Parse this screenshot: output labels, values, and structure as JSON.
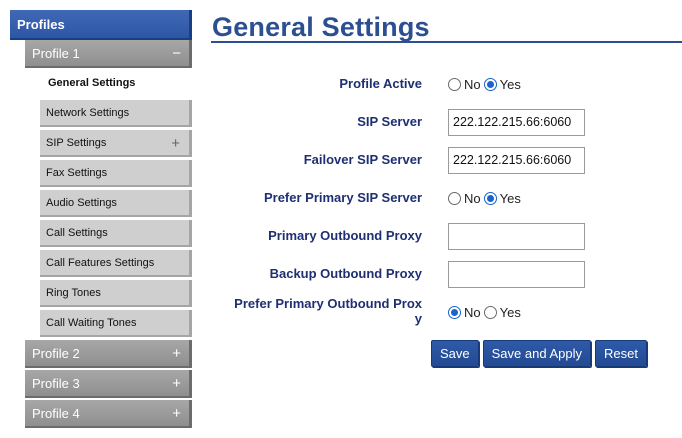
{
  "sidebar": {
    "top_label": "Profiles",
    "profiles": [
      {
        "label": "Profile 1",
        "toggle": "−"
      },
      {
        "label": "Profile 2",
        "toggle": "+"
      },
      {
        "label": "Profile 3",
        "toggle": "+"
      },
      {
        "label": "Profile 4",
        "toggle": "+"
      }
    ],
    "sub_items": [
      {
        "label": "General Settings"
      },
      {
        "label": "Network Settings"
      },
      {
        "label": "SIP Settings",
        "toggle": "+"
      },
      {
        "label": "Fax Settings"
      },
      {
        "label": "Audio Settings"
      },
      {
        "label": "Call Settings"
      },
      {
        "label": "Call Features Settings"
      },
      {
        "label": "Ring Tones"
      },
      {
        "label": "Call Waiting Tones"
      }
    ]
  },
  "main": {
    "title": "General Settings",
    "fields": {
      "profile_active": {
        "label": "Profile Active",
        "no": "No",
        "yes": "Yes",
        "selected": "Yes"
      },
      "sip_server": {
        "label": "SIP Server",
        "value": "222.122.215.66:6060"
      },
      "failover_sip_server": {
        "label": "Failover SIP Server",
        "value": "222.122.215.66:6060"
      },
      "prefer_primary_sip": {
        "label": "Prefer Primary SIP Server",
        "no": "No",
        "yes": "Yes",
        "selected": "Yes"
      },
      "primary_outbound_proxy": {
        "label": "Primary Outbound Proxy",
        "value": ""
      },
      "backup_outbound_proxy": {
        "label": "Backup Outbound Proxy",
        "value": ""
      },
      "prefer_primary_outbound": {
        "label_line1": "Prefer Primary Outbound Prox",
        "label_line2": "y",
        "no": "No",
        "yes": "Yes",
        "selected": "No"
      }
    },
    "buttons": {
      "save": "Save",
      "save_apply": "Save and Apply",
      "reset": "Reset"
    }
  },
  "colors": {
    "accent": "#2b4f91",
    "label": "#1e2f73",
    "nav_blue": "#3f69b6",
    "nav_gray": "#9b9b9b",
    "sub_gray": "#cfcfcf"
  }
}
